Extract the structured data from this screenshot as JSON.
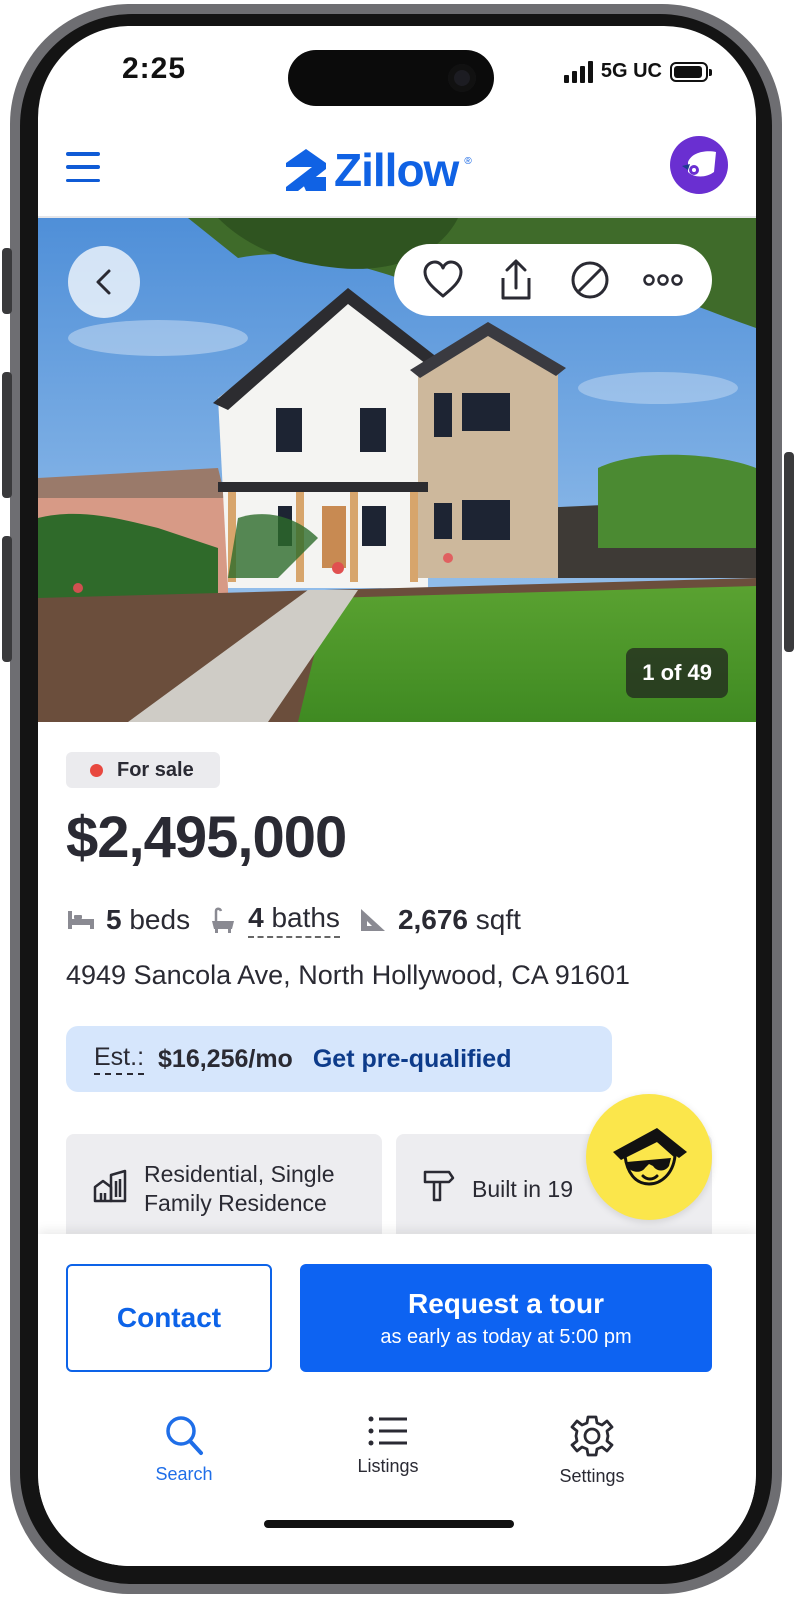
{
  "status_bar": {
    "time": "2:25",
    "network": "5G UC"
  },
  "header": {
    "logo": "Zillow",
    "logo_reg": "®"
  },
  "photo": {
    "counter": "1 of 49"
  },
  "listing": {
    "status": "For sale",
    "price": "$2,495,000",
    "beds_num": "5",
    "beds_label": "beds",
    "baths_num": "4",
    "baths_label": "baths",
    "sqft_num": "2,676",
    "sqft_label": "sqft",
    "address": "4949 Sancola Ave, North Hollywood, CA 91601",
    "est_label": "Est.:",
    "est_value": "$16,256/mo",
    "est_link": "Get pre-qualified"
  },
  "cards": [
    {
      "line1": "Residential, Single",
      "line2": "Family Residence",
      "icon": "building-icon"
    },
    {
      "line1": "Built in 19",
      "icon": "hammer-icon"
    }
  ],
  "actions": {
    "contact": "Contact",
    "tour_title": "Request a tour",
    "tour_sub": "as early as today at 5:00 pm"
  },
  "tabs": [
    {
      "label": "Search",
      "icon": "search-icon",
      "active": true
    },
    {
      "label": "Listings",
      "icon": "list-icon",
      "active": false
    },
    {
      "label": "Settings",
      "icon": "gear-icon",
      "active": false
    }
  ],
  "colors": {
    "brand": "#1062e4",
    "primary_button": "#0d63f2",
    "est_bg": "#d6e6fc",
    "fab": "#fbe64b",
    "status_dot": "#e8483f"
  }
}
